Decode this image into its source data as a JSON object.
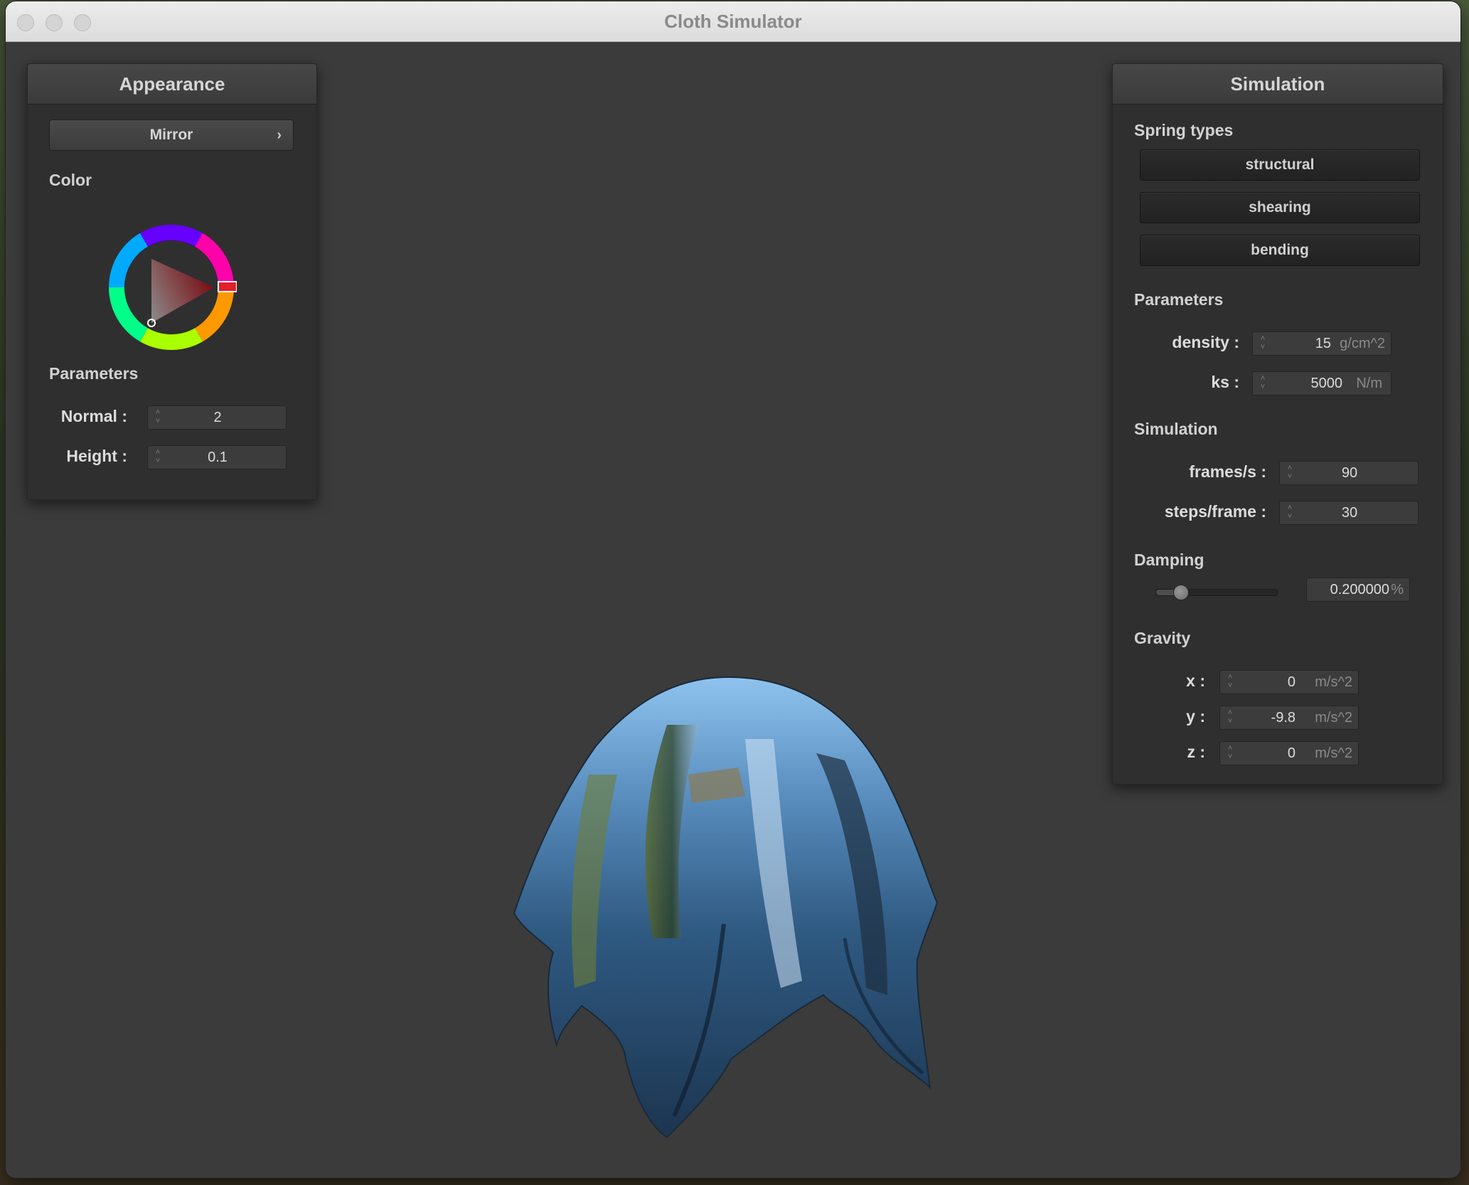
{
  "window": {
    "title": "Cloth Simulator"
  },
  "appearance": {
    "header": "Appearance",
    "shader": "Mirror",
    "color_label": "Color",
    "color": "#e0202a",
    "params_label": "Parameters",
    "normal": {
      "label": "Normal :",
      "value": "2"
    },
    "height": {
      "label": "Height :",
      "value": "0.1"
    }
  },
  "simulation_panel": {
    "header": "Simulation",
    "spring_types_label": "Spring types",
    "springs": [
      "structural",
      "shearing",
      "bending"
    ],
    "params_label": "Parameters",
    "density": {
      "label": "density :",
      "value": "15",
      "unit": "g/cm^2"
    },
    "ks": {
      "label": "ks :",
      "value": "5000",
      "unit": "N/m"
    },
    "sim_label": "Simulation",
    "fps": {
      "label": "frames/s :",
      "value": "90"
    },
    "steps": {
      "label": "steps/frame :",
      "value": "30"
    },
    "damping_label": "Damping",
    "damping": {
      "value": "0.200000",
      "unit": "%",
      "level": 0.2
    },
    "gravity_label": "Gravity",
    "gravity": [
      {
        "label": "x :",
        "value": "0",
        "unit": "m/s^2"
      },
      {
        "label": "y :",
        "value": "-9.8",
        "unit": "m/s^2"
      },
      {
        "label": "z :",
        "value": "0",
        "unit": "m/s^2"
      }
    ]
  },
  "icons": {
    "close": "traffic-light-close",
    "minimize": "traffic-light-minimize",
    "zoom": "traffic-light-zoom",
    "chevron": "chevron-right-icon",
    "spinner": "spinner-arrows-icon"
  }
}
